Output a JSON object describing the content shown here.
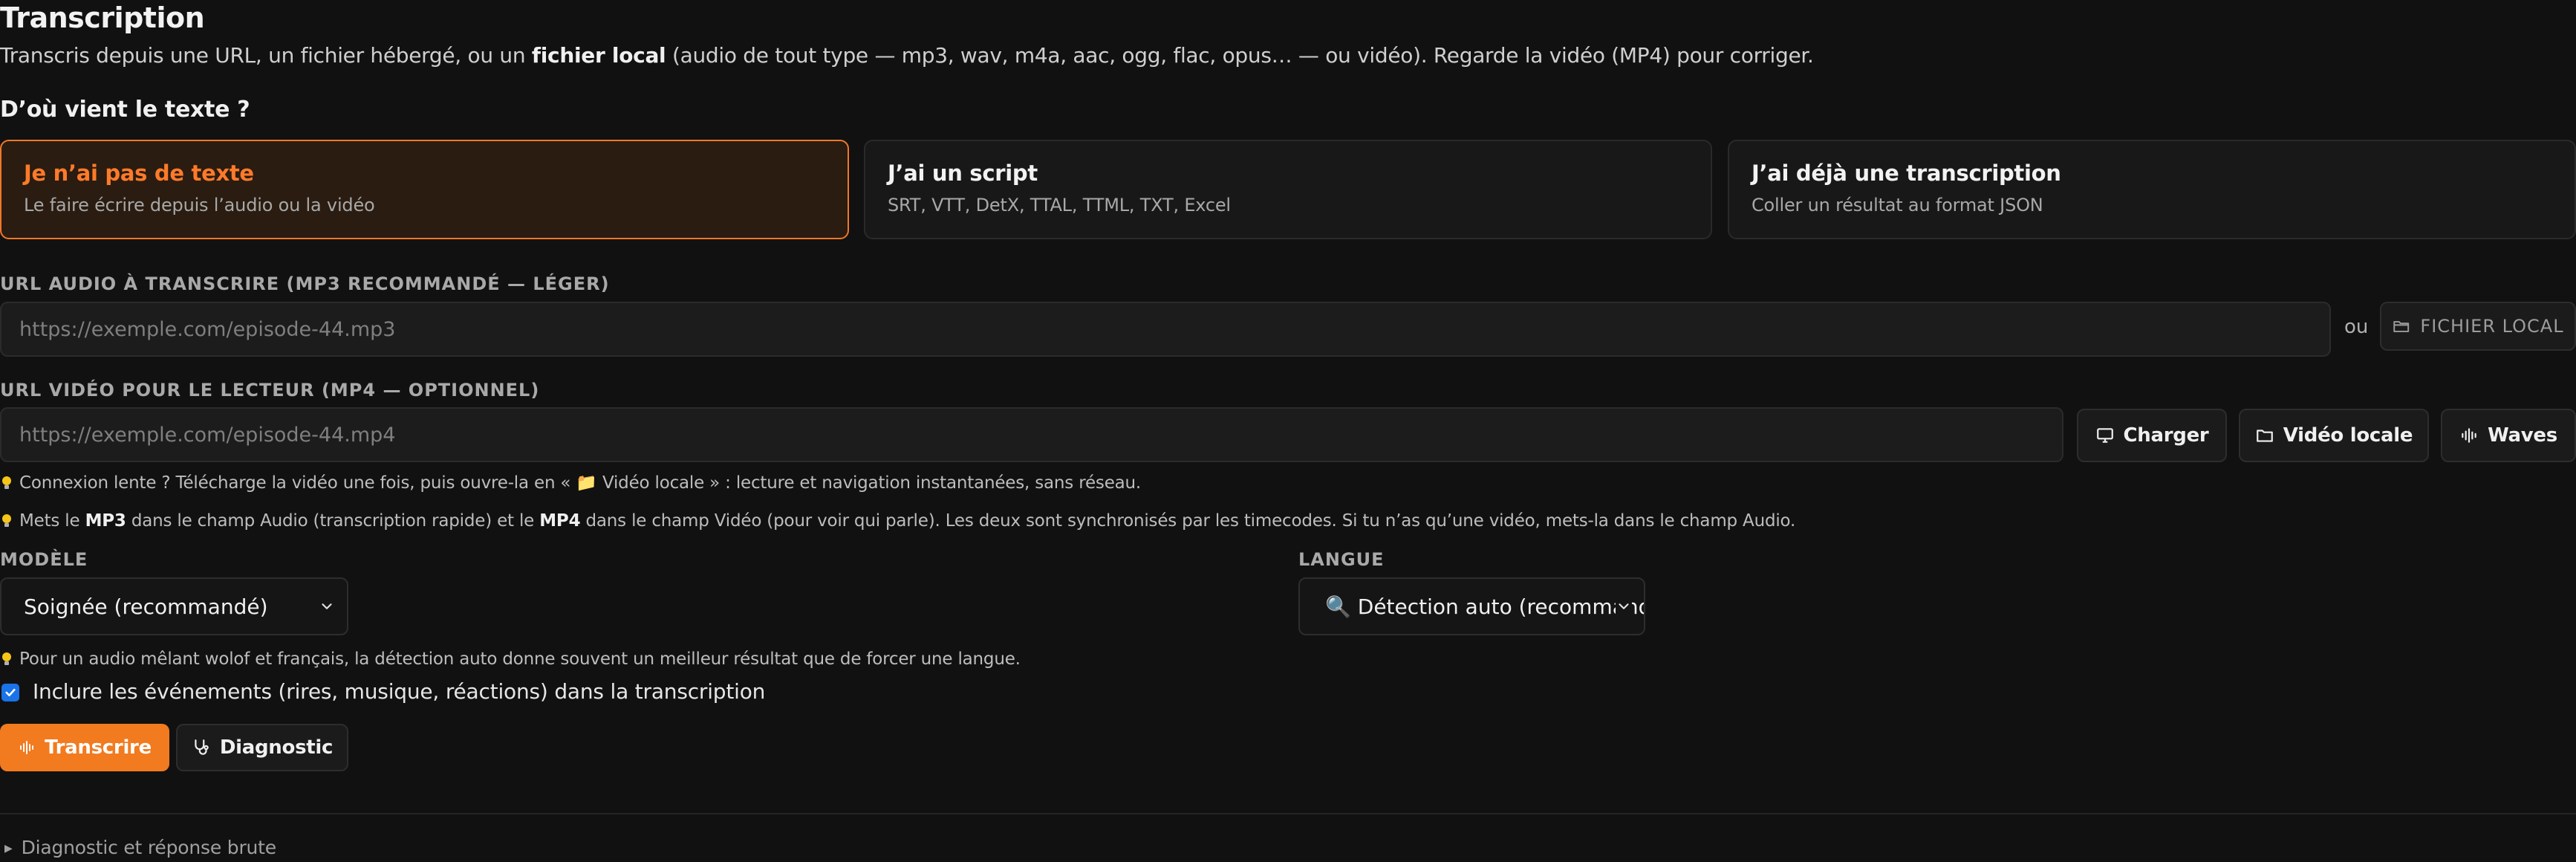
{
  "header": {
    "title": "Transcription",
    "subtitle_pre": "Transcris depuis une URL, un fichier hébergé, ou un ",
    "subtitle_bold": "fichier local",
    "subtitle_post": " (audio de tout type — mp3, wav, m4a, aac, ogg, flac, opus… — ou vidéo). Regarde la vidéo (MP4) pour corriger."
  },
  "source": {
    "question": "D’où vient le texte ?",
    "cards": [
      {
        "title": "Je n’ai pas de texte",
        "subtitle": "Le faire écrire depuis l’audio ou la vidéo",
        "active": true
      },
      {
        "title": "J’ai un script",
        "subtitle": "SRT, VTT, DetX, TTAL, TTML, TXT, Excel",
        "active": false
      },
      {
        "title": "J’ai déjà une transcription",
        "subtitle": "Coller un résultat au format JSON",
        "active": false
      }
    ]
  },
  "audio": {
    "label": "URL AUDIO À TRANSCRIRE (MP3 RECOMMANDÉ — LÉGER)",
    "placeholder": "https://exemple.com/episode-44.mp3",
    "value": "",
    "or_text": "ou",
    "local_file_button": "FICHIER LOCAL"
  },
  "video": {
    "label": "URL VIDÉO POUR LE LECTEUR (MP4 — OPTIONNEL)",
    "placeholder": "https://exemple.com/episode-44.mp4",
    "value": "",
    "load_button": "Charger",
    "local_video_button": "Vidéo locale",
    "waves_button": "Waves"
  },
  "hints": {
    "slow_connection": "Connexion lente ? Télécharge la vidéo une fois, puis ouvre-la en « 📁 Vidéo locale » : lecture et navigation instantanées, sans réseau.",
    "mp3_mp4_1": "Mets le ",
    "mp3_mp4_b1": "MP3",
    "mp3_mp4_2": " dans le champ Audio (transcription rapide) et le ",
    "mp3_mp4_b2": "MP4",
    "mp3_mp4_3": " dans le champ Vidéo (pour voir qui parle). Les deux sont synchronisés par les timecodes. Si tu n’as qu’une vidéo, mets-la dans le champ Audio.",
    "language_tip": "Pour un audio mêlant wolof et français, la détection auto donne souvent un meilleur résultat que de forcer une langue."
  },
  "model": {
    "label": "MODÈLE",
    "selected": "Soignée (recommandé)"
  },
  "language": {
    "label": "LANGUE",
    "selected": "🔍 Détection auto (recommandé)"
  },
  "events": {
    "checked": true,
    "label": "Inclure les événements (rires, musique, réactions) dans la transcription"
  },
  "actions": {
    "transcribe_button": "Transcrire",
    "diagnostic_button": "Diagnostic"
  },
  "footer": {
    "details_label": "Diagnostic et réponse brute"
  },
  "colors": {
    "accent": "#f27a1f",
    "background": "#111111",
    "checkbox": "#1a73e8"
  }
}
